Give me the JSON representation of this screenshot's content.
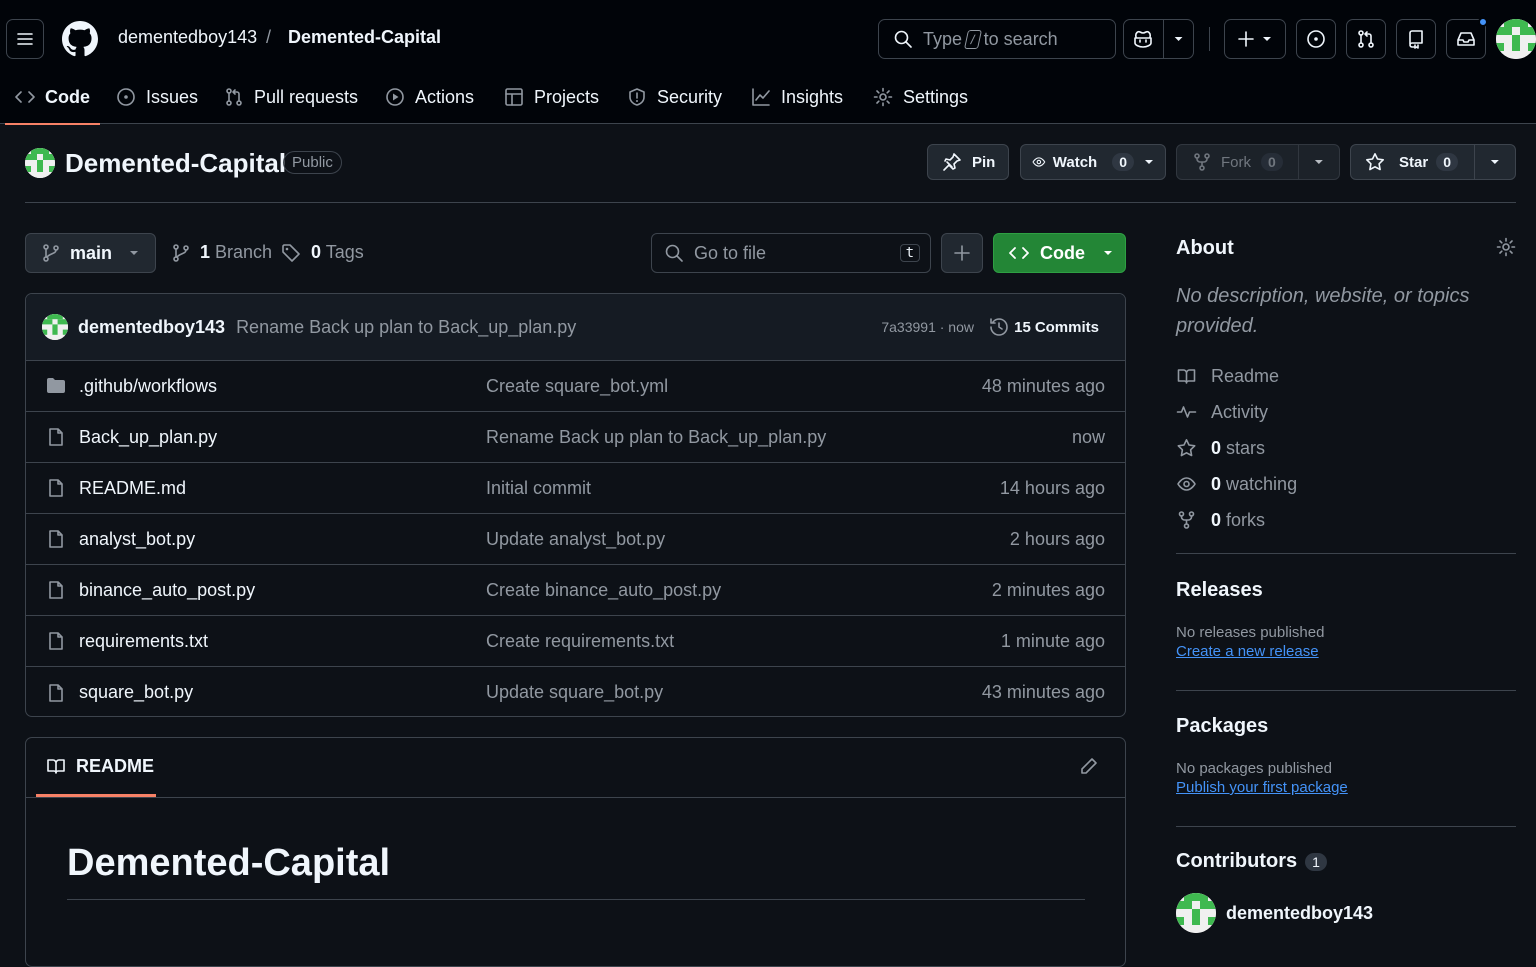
{
  "header": {
    "owner": "dementedboy143",
    "separator": "/",
    "repo": "Demented-Capital",
    "search": {
      "prefix": "Type",
      "key": "/",
      "suffix": "to search"
    }
  },
  "nav": {
    "tabs": [
      {
        "label": "Code",
        "icon": "code-icon",
        "selected": true
      },
      {
        "label": "Issues",
        "icon": "issue-icon"
      },
      {
        "label": "Pull requests",
        "icon": "pull-request-icon"
      },
      {
        "label": "Actions",
        "icon": "play-icon"
      },
      {
        "label": "Projects",
        "icon": "table-icon"
      },
      {
        "label": "Security",
        "icon": "shield-icon"
      },
      {
        "label": "Insights",
        "icon": "graph-icon"
      },
      {
        "label": "Settings",
        "icon": "gear-icon"
      }
    ]
  },
  "repo_header": {
    "title": "Demented-Capital",
    "visibility": "Public",
    "pin_label": "Pin",
    "watch_label": "Watch",
    "watch_count": "0",
    "fork_label": "Fork",
    "fork_count": "0",
    "star_label": "Star",
    "star_count": "0"
  },
  "toolbar": {
    "branch": "main",
    "branch_count": "1",
    "branch_label": "Branch",
    "tag_count": "0",
    "tag_label": "Tags",
    "go_to_file": "Go to file",
    "go_to_file_key": "t",
    "code_button": "Code"
  },
  "latest_commit": {
    "author": "dementedboy143",
    "message": "Rename Back up plan to Back_up_plan.py",
    "hash_time": "7a33991 · now",
    "commits_count": "15",
    "commits_label": "Commits"
  },
  "files": [
    {
      "name": ".github/workflows",
      "type": "folder",
      "message": "Create square_bot.yml",
      "time": "48 minutes ago"
    },
    {
      "name": "Back_up_plan.py",
      "type": "file",
      "message": "Rename Back up plan to Back_up_plan.py",
      "time": "now"
    },
    {
      "name": "README.md",
      "type": "file",
      "message": "Initial commit",
      "time": "14 hours ago"
    },
    {
      "name": "analyst_bot.py",
      "type": "file",
      "message": "Update analyst_bot.py",
      "time": "2 hours ago"
    },
    {
      "name": "binance_auto_post.py",
      "type": "file",
      "message": "Create binance_auto_post.py",
      "time": "2 minutes ago"
    },
    {
      "name": "requirements.txt",
      "type": "file",
      "message": "Create requirements.txt",
      "time": "1 minute ago"
    },
    {
      "name": "square_bot.py",
      "type": "file",
      "message": "Update square_bot.py",
      "time": "43 minutes ago"
    }
  ],
  "readme": {
    "tab_label": "README",
    "heading": "Demented-Capital"
  },
  "about": {
    "title": "About",
    "description": "No description, website, or topics provided.",
    "items": [
      {
        "icon": "book-icon",
        "strong": "",
        "label": "Readme"
      },
      {
        "icon": "pulse-icon",
        "strong": "",
        "label": "Activity"
      },
      {
        "icon": "star-icon",
        "strong": "0",
        "label": "stars"
      },
      {
        "icon": "eye-icon",
        "strong": "0",
        "label": "watching"
      },
      {
        "icon": "fork-icon",
        "strong": "0",
        "label": "forks"
      }
    ]
  },
  "releases": {
    "title": "Releases",
    "empty": "No releases published",
    "link": "Create a new release"
  },
  "packages": {
    "title": "Packages",
    "empty": "No packages published",
    "link": "Publish your first package"
  },
  "contributors": {
    "title": "Contributors",
    "count": "1",
    "name": "dementedboy143"
  },
  "colors": {
    "accent": "#f78166",
    "primary_button": "#238636",
    "link": "#4493f8",
    "avatar": "#3fb950"
  }
}
